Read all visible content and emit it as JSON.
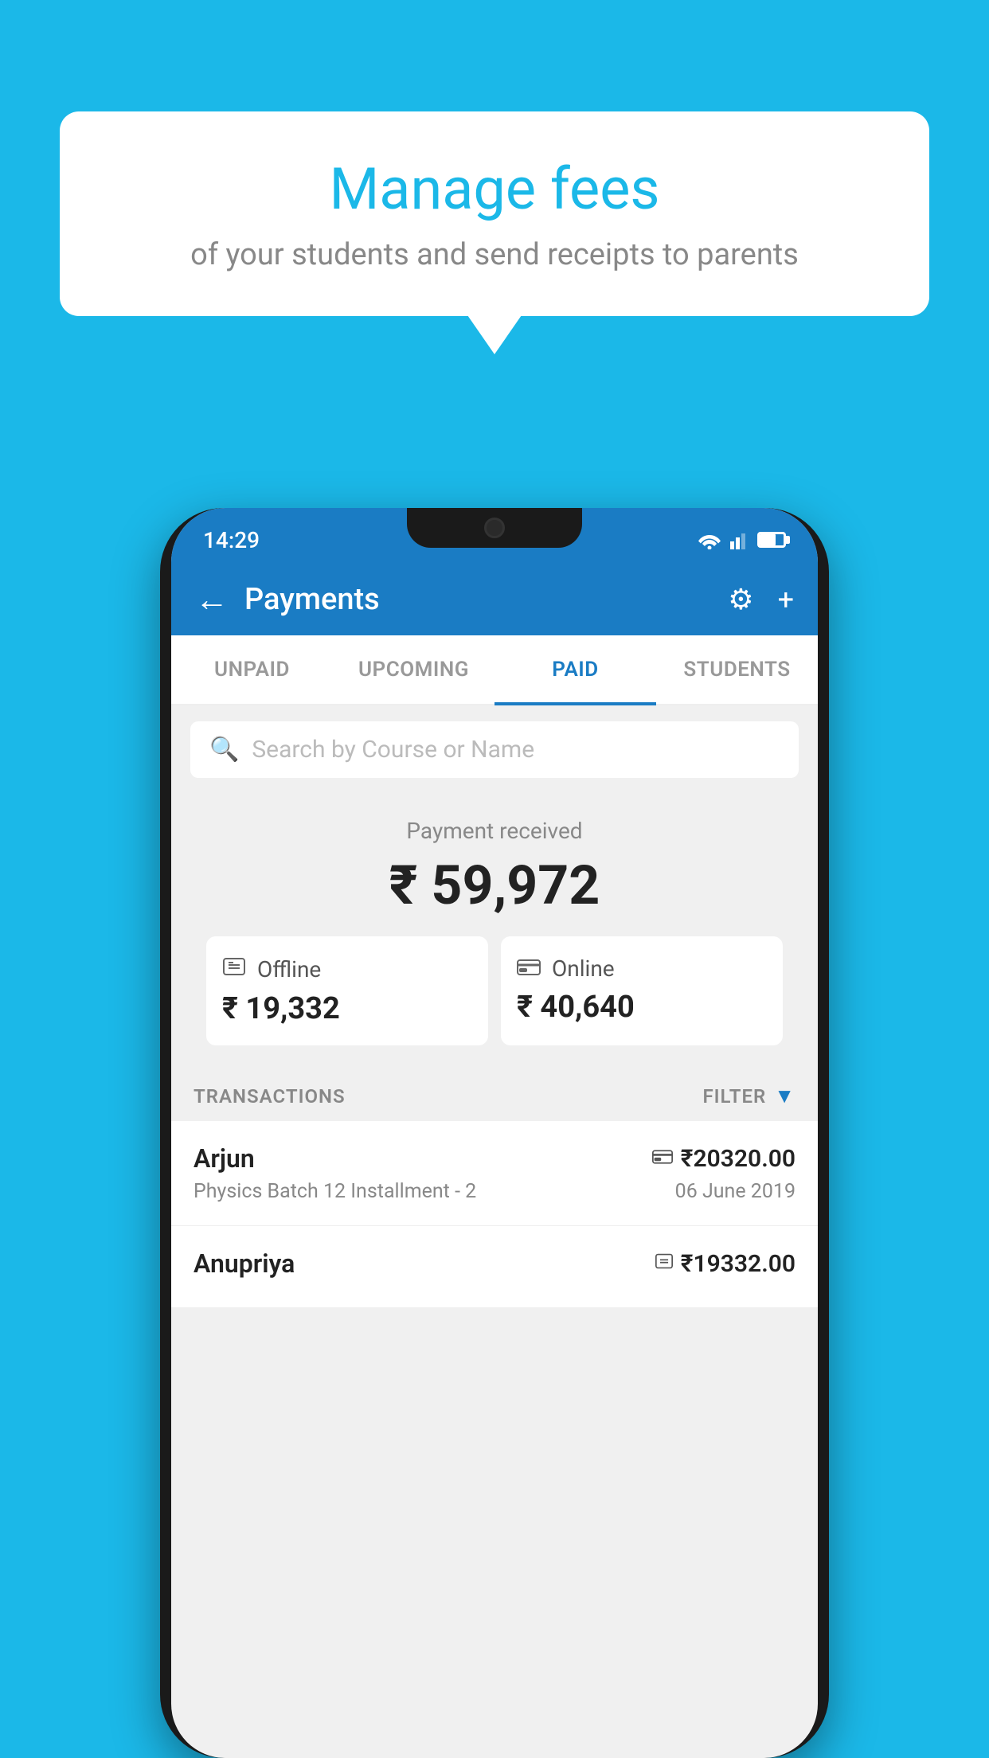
{
  "page": {
    "background_color": "#1bb8e8"
  },
  "speech_bubble": {
    "title": "Manage fees",
    "subtitle": "of your students and send receipts to parents"
  },
  "status_bar": {
    "time": "14:29"
  },
  "header": {
    "title": "Payments",
    "back_label": "←",
    "settings_label": "⚙",
    "add_label": "+"
  },
  "tabs": [
    {
      "id": "unpaid",
      "label": "UNPAID",
      "active": false
    },
    {
      "id": "upcoming",
      "label": "UPCOMING",
      "active": false
    },
    {
      "id": "paid",
      "label": "PAID",
      "active": true
    },
    {
      "id": "students",
      "label": "STUDENTS",
      "active": false
    }
  ],
  "search": {
    "placeholder": "Search by Course or Name"
  },
  "payment_summary": {
    "label": "Payment received",
    "amount": "₹ 59,972",
    "offline": {
      "type": "Offline",
      "amount": "₹ 19,332"
    },
    "online": {
      "type": "Online",
      "amount": "₹ 40,640"
    }
  },
  "transactions": {
    "label": "TRANSACTIONS",
    "filter_label": "FILTER",
    "items": [
      {
        "name": "Arjun",
        "course": "Physics Batch 12 Installment - 2",
        "amount": "₹20320.00",
        "date": "06 June 2019",
        "payment_icon": "card"
      },
      {
        "name": "Anupriya",
        "course": "",
        "amount": "₹19332.00",
        "date": "",
        "payment_icon": "cash"
      }
    ]
  }
}
